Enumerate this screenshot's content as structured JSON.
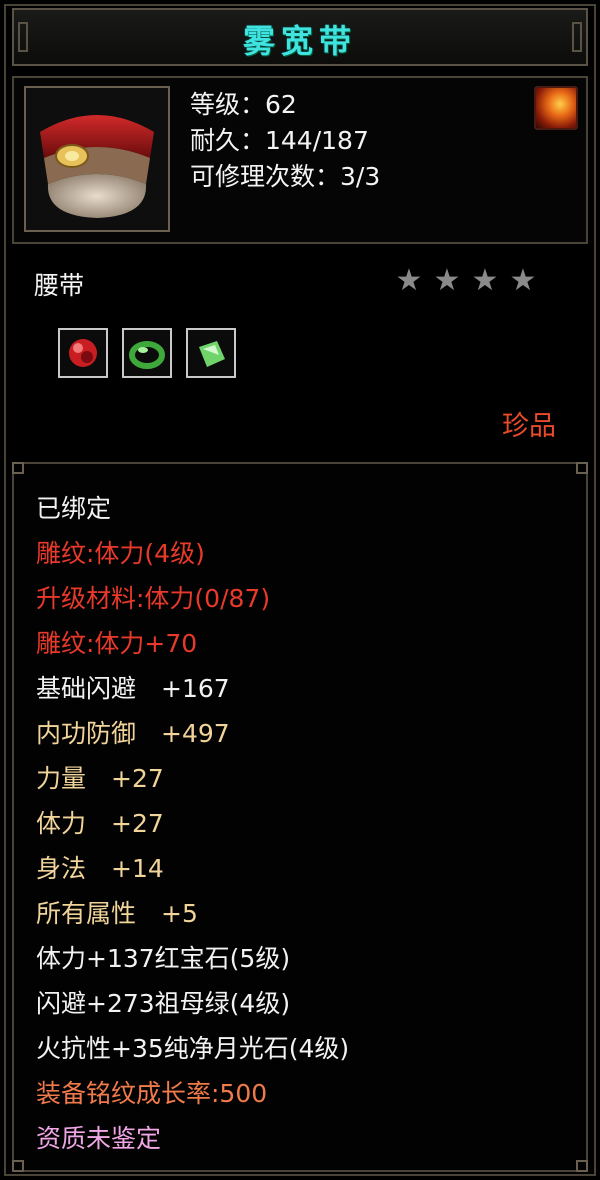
{
  "item": {
    "name": "雾宽带",
    "level_line": "等级：62",
    "durability_line": "耐久：144/187",
    "repair_line": "可修理次数：3/3",
    "type": "腰带",
    "star_count": 4,
    "rarity": "珍品",
    "gems": [
      {
        "icon": "ruby-gem-icon",
        "color": "#c81e22"
      },
      {
        "icon": "jade-ring-icon",
        "color": "#3fa83a"
      },
      {
        "icon": "emerald-gem-icon",
        "color": "#6fd46a"
      }
    ],
    "badge_icon": "flame-badge-icon"
  },
  "attributes": [
    {
      "text": "已绑定",
      "color": "white"
    },
    {
      "text": "雕纹:体力(4级)",
      "color": "red"
    },
    {
      "text": "升级材料:体力(0/87)",
      "color": "red"
    },
    {
      "text": "雕纹:体力+70",
      "color": "red"
    },
    {
      "text": "基础闪避　+167",
      "color": "white"
    },
    {
      "text": "内功防御　+497",
      "color": "gold"
    },
    {
      "text": "力量　+27",
      "color": "gold"
    },
    {
      "text": "体力　+27",
      "color": "gold"
    },
    {
      "text": "身法　+14",
      "color": "gold"
    },
    {
      "text": "所有属性　+5",
      "color": "gold"
    },
    {
      "text": "体力+137红宝石(5级)",
      "color": "white"
    },
    {
      "text": "闪避+273祖母绿(4级)",
      "color": "white"
    },
    {
      "text": "火抗性+35纯净月光石(4级)",
      "color": "white"
    },
    {
      "text": "装备铭纹成长率:500",
      "color": "orange"
    },
    {
      "text": "资质未鉴定",
      "color": "pink"
    }
  ],
  "colors": {
    "title": "#3fe3e0",
    "white": "#f2f2f2",
    "red": "#e8392a",
    "gold": "#f1d49a",
    "orange": "#f07a4a",
    "pink": "#f1a6e6",
    "rarity": "#e84b2c"
  }
}
